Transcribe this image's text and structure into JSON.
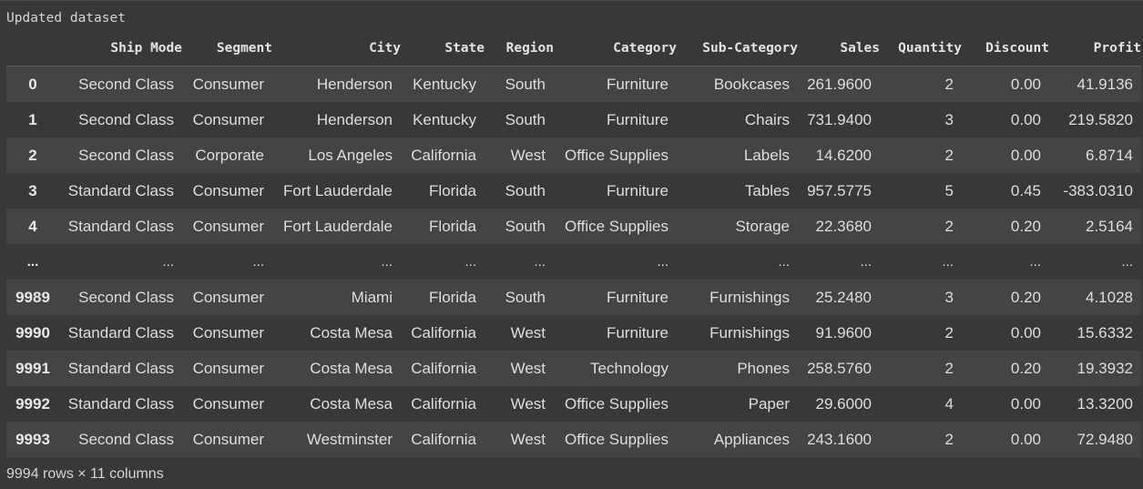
{
  "output": {
    "title": "Updated dataset",
    "footer": "9994 rows × 11 columns"
  },
  "table": {
    "columns": [
      "",
      "Ship Mode",
      "Segment",
      "City",
      "State",
      "Region",
      "Category",
      "Sub-Category",
      "Sales",
      "Quantity",
      "Discount",
      "Profit"
    ],
    "rows": [
      [
        "0",
        "Second Class",
        "Consumer",
        "Henderson",
        "Kentucky",
        "South",
        "Furniture",
        "Bookcases",
        "261.9600",
        "2",
        "0.00",
        "41.9136"
      ],
      [
        "1",
        "Second Class",
        "Consumer",
        "Henderson",
        "Kentucky",
        "South",
        "Furniture",
        "Chairs",
        "731.9400",
        "3",
        "0.00",
        "219.5820"
      ],
      [
        "2",
        "Second Class",
        "Corporate",
        "Los Angeles",
        "California",
        "West",
        "Office Supplies",
        "Labels",
        "14.6200",
        "2",
        "0.00",
        "6.8714"
      ],
      [
        "3",
        "Standard Class",
        "Consumer",
        "Fort Lauderdale",
        "Florida",
        "South",
        "Furniture",
        "Tables",
        "957.5775",
        "5",
        "0.45",
        "-383.0310"
      ],
      [
        "4",
        "Standard Class",
        "Consumer",
        "Fort Lauderdale",
        "Florida",
        "South",
        "Office Supplies",
        "Storage",
        "22.3680",
        "2",
        "0.20",
        "2.5164"
      ],
      [
        "...",
        "...",
        "...",
        "...",
        "...",
        "...",
        "...",
        "...",
        "...",
        "...",
        "...",
        "..."
      ],
      [
        "9989",
        "Second Class",
        "Consumer",
        "Miami",
        "Florida",
        "South",
        "Furniture",
        "Furnishings",
        "25.2480",
        "3",
        "0.20",
        "4.1028"
      ],
      [
        "9990",
        "Standard Class",
        "Consumer",
        "Costa Mesa",
        "California",
        "West",
        "Furniture",
        "Furnishings",
        "91.9600",
        "2",
        "0.00",
        "15.6332"
      ],
      [
        "9991",
        "Standard Class",
        "Consumer",
        "Costa Mesa",
        "California",
        "West",
        "Technology",
        "Phones",
        "258.5760",
        "2",
        "0.20",
        "19.3932"
      ],
      [
        "9992",
        "Standard Class",
        "Consumer",
        "Costa Mesa",
        "California",
        "West",
        "Office Supplies",
        "Paper",
        "29.6000",
        "4",
        "0.00",
        "13.3200"
      ],
      [
        "9993",
        "Second Class",
        "Consumer",
        "Westminster",
        "California",
        "West",
        "Office Supplies",
        "Appliances",
        "243.1600",
        "2",
        "0.00",
        "72.9480"
      ]
    ]
  }
}
